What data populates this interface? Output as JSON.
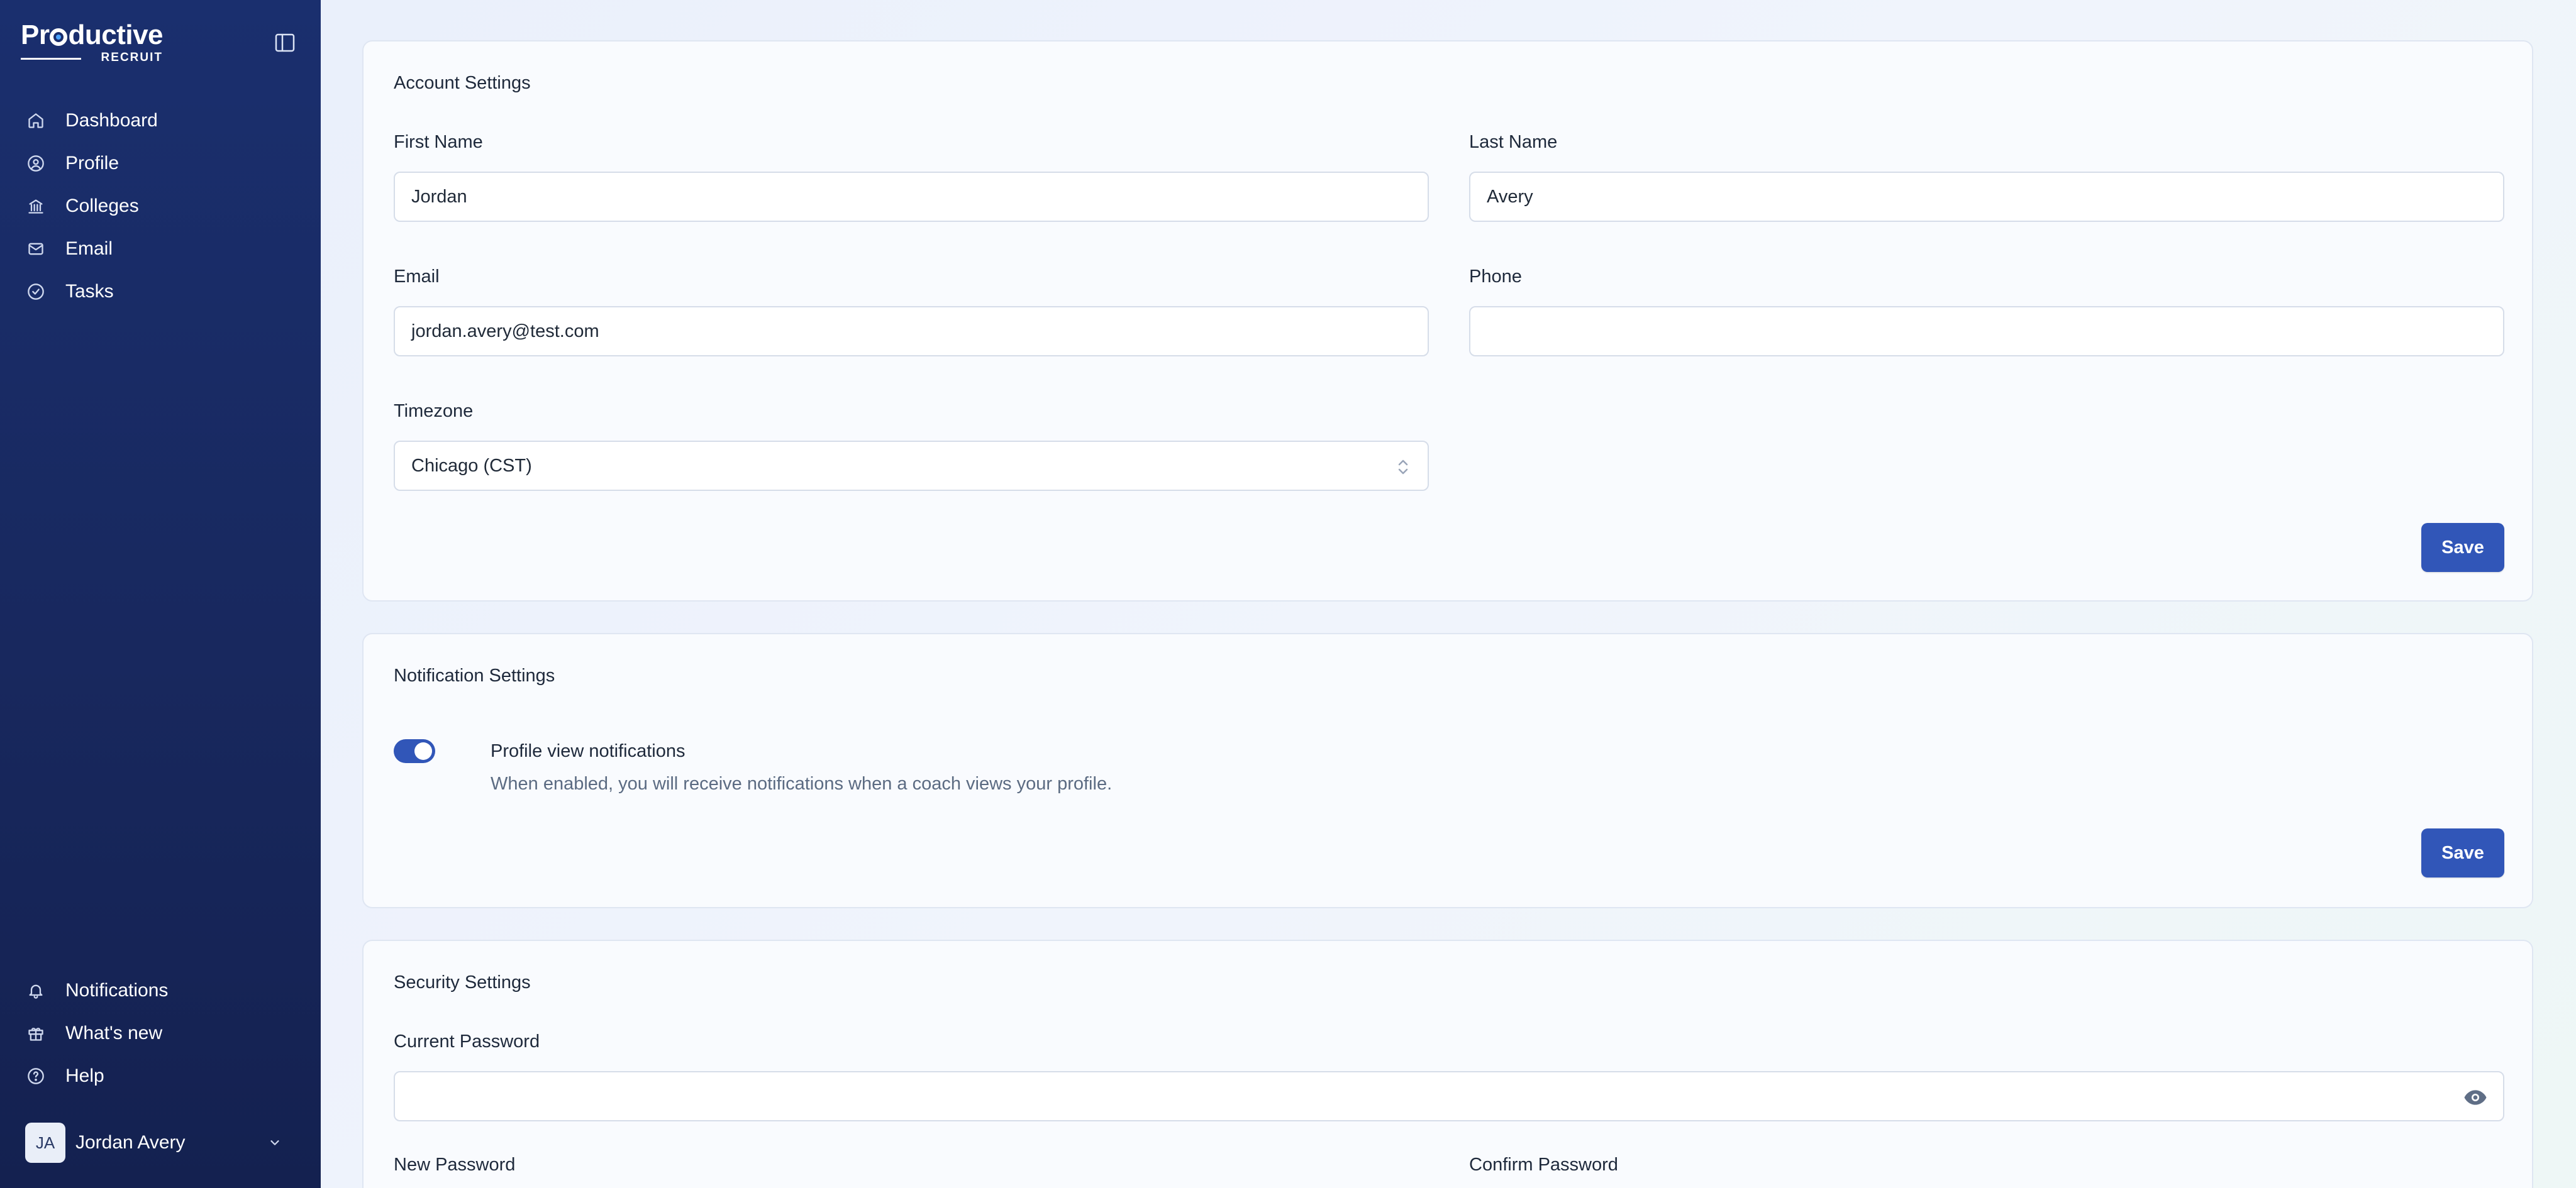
{
  "brand": {
    "name": "Productive",
    "sub": "RECRUIT"
  },
  "sidebar": {
    "items": [
      {
        "label": "Dashboard",
        "icon": "home-icon"
      },
      {
        "label": "Profile",
        "icon": "user-circle-icon"
      },
      {
        "label": "Colleges",
        "icon": "building-icon"
      },
      {
        "label": "Email",
        "icon": "mail-icon"
      },
      {
        "label": "Tasks",
        "icon": "check-circle-icon"
      }
    ],
    "bottom_items": [
      {
        "label": "Notifications",
        "icon": "bell-icon"
      },
      {
        "label": "What's new",
        "icon": "gift-icon"
      },
      {
        "label": "Help",
        "icon": "help-circle-icon"
      }
    ],
    "user": {
      "initials": "JA",
      "name": "Jordan Avery"
    }
  },
  "account": {
    "title": "Account Settings",
    "first_name_label": "First Name",
    "first_name_value": "Jordan",
    "last_name_label": "Last Name",
    "last_name_value": "Avery",
    "email_label": "Email",
    "email_value": "jordan.avery@test.com",
    "phone_label": "Phone",
    "phone_value": "",
    "timezone_label": "Timezone",
    "timezone_value": "Chicago (CST)",
    "save_label": "Save"
  },
  "notifications": {
    "title": "Notification Settings",
    "toggle_label": "Profile view notifications",
    "toggle_enabled": true,
    "toggle_desc": "When enabled, you will receive notifications when a coach views your profile.",
    "save_label": "Save"
  },
  "security": {
    "title": "Security Settings",
    "current_password_label": "Current Password",
    "new_password_label": "New Password",
    "confirm_password_label": "Confirm Password"
  },
  "colors": {
    "sidebar_bg": "#1a2f6e",
    "accent": "#3156b8",
    "card_bg": "#f9fbfe"
  }
}
